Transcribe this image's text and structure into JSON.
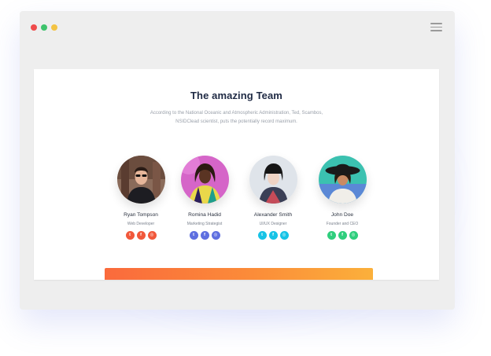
{
  "window": {
    "traffic_lights": [
      "#ef4b4b",
      "#3ec36c",
      "#f3c343"
    ],
    "menu_icon": "hamburger-icon"
  },
  "section": {
    "title": "The amazing Team",
    "description": "According to the National Oceanic and Atmospheric Administration, Ted, Scambos, NSIDClead scientist, puts the potentially record maximum."
  },
  "team": [
    {
      "name": "Ryan Tompson",
      "role": "Web Developer",
      "social_color": "#f1583b",
      "socials": [
        "twitter",
        "facebook",
        "dribbble"
      ]
    },
    {
      "name": "Romina Hadid",
      "role": "Marketing Strategist",
      "social_color": "#5e6fe0",
      "socials": [
        "twitter",
        "facebook",
        "dribbble"
      ]
    },
    {
      "name": "Alexander Smith",
      "role": "UI/UX Designer",
      "social_color": "#17c3e6",
      "socials": [
        "twitter",
        "facebook",
        "dribbble"
      ]
    },
    {
      "name": "John Doe",
      "role": "Founder and CEO",
      "social_color": "#2fce7d",
      "socials": [
        "twitter",
        "facebook",
        "dribbble"
      ]
    }
  ],
  "icons": {
    "twitter": "twitter-icon",
    "facebook": "facebook-icon",
    "dribbble": "dribbble-icon"
  }
}
